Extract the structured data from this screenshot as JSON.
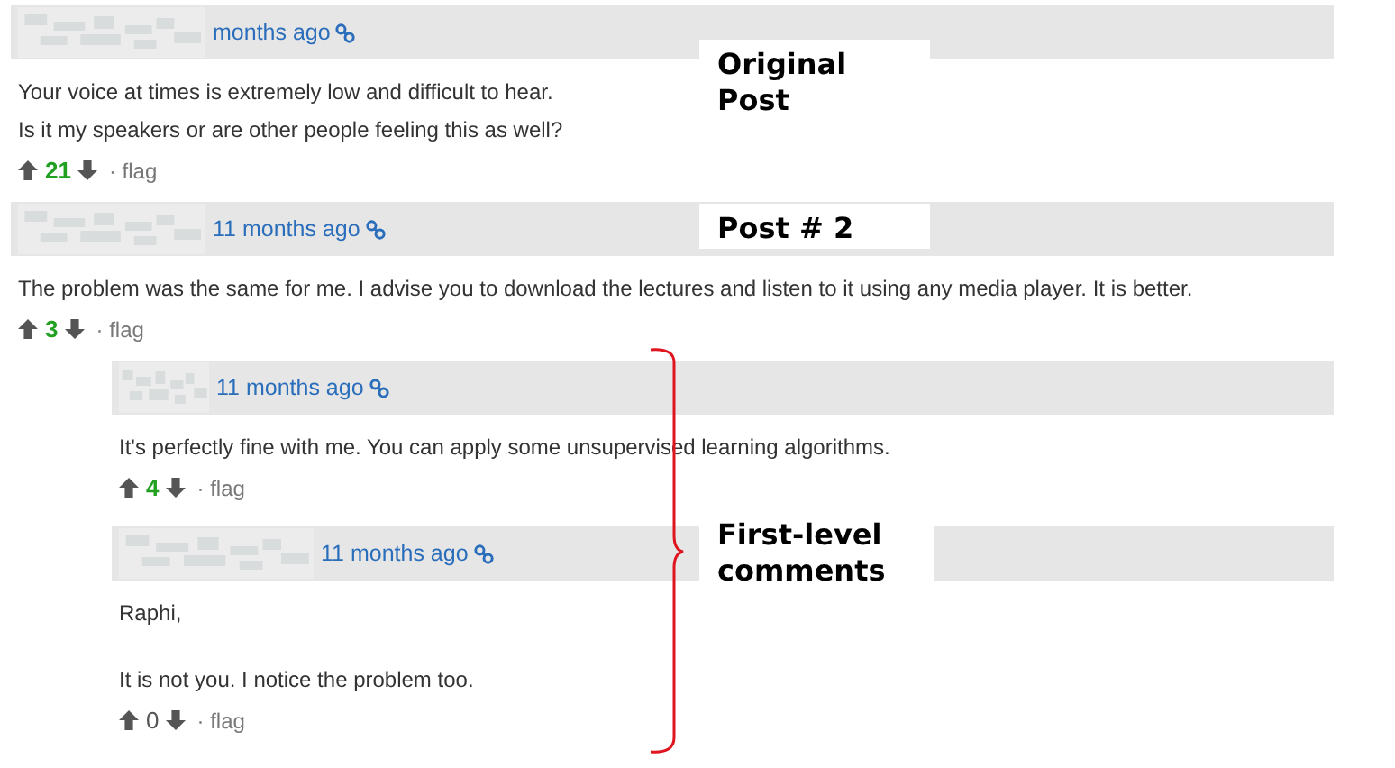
{
  "posts": [
    {
      "time": "months ago",
      "body": [
        [
          "Your voice at times is extremely low and difficult to hear.",
          "Is it my speakers or are other people feeling this as well?"
        ]
      ],
      "score": "21",
      "score_positive": true,
      "flag": "· flag"
    },
    {
      "time": "11 months ago",
      "body": [
        [
          "The problem was the same for me. I advise you to download the lectures and listen to it using any media player. It is better."
        ]
      ],
      "score": "3",
      "score_positive": true,
      "flag": "· flag",
      "children": [
        {
          "time": "11 months ago",
          "body": [
            [
              "It's perfectly fine with me.  You can apply some unsupervised learning algorithms."
            ]
          ],
          "score": "4",
          "score_positive": true,
          "flag": "· flag"
        },
        {
          "time": "11 months ago",
          "body": [
            [
              "Raphi,"
            ],
            [
              "It is not you. I notice the problem too."
            ]
          ],
          "score": "0",
          "score_positive": false,
          "flag": "· flag"
        }
      ]
    }
  ],
  "annotations": [
    {
      "kind": "box",
      "text": "Original Post"
    },
    {
      "kind": "box",
      "text": "Post # 2"
    },
    {
      "kind": "brace",
      "text": "First-level comments"
    }
  ]
}
